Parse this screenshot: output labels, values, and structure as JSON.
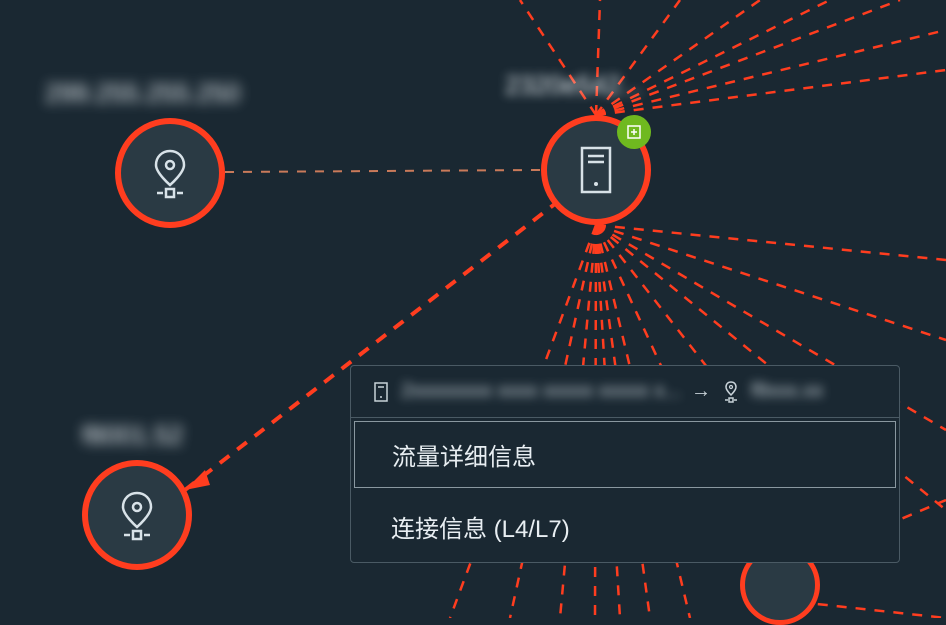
{
  "nodes": {
    "top_left": {
      "label": "299.255.255.250",
      "type": "location"
    },
    "center": {
      "label": "2320e542...",
      "type": "server",
      "has_badge": true
    },
    "bottom_left": {
      "label": "f8001.52",
      "type": "location"
    }
  },
  "context_menu": {
    "source_label": "2xxxxxxxx xxxx xxxxx xxxxx x...",
    "target_label": "f8xxx.xx",
    "items": [
      {
        "label": "流量详细信息",
        "selected": true
      },
      {
        "label": "连接信息 (L4/L7)",
        "selected": false
      }
    ]
  },
  "colors": {
    "bg": "#1a2832",
    "node_ring": "#ff3d1f",
    "node_fill": "#2a3a44",
    "badge": "#6fb91f",
    "text": "#e8eef2"
  }
}
